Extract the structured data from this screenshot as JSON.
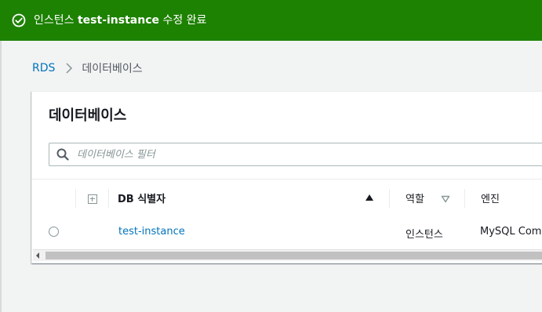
{
  "flash": {
    "icon": "check-circle-icon",
    "prefix": "인스턴스 ",
    "instance_name": "test-instance",
    "suffix": " 수정 완료",
    "color": "#1d8102"
  },
  "breadcrumb": {
    "root": "RDS",
    "separator_icon": "chevron-right-icon",
    "current": "데이터베이스"
  },
  "panel": {
    "title": "데이터베이스",
    "filter": {
      "icon": "search-icon",
      "placeholder": "데이터베이스 필터",
      "value": ""
    },
    "table": {
      "headers": {
        "expand_icon": "expand-all-icon",
        "db_identifier": "DB 식별자",
        "role": "역할",
        "engine": "엔진"
      },
      "rows": [
        {
          "db_identifier": "test-instance",
          "role": "인스턴스",
          "engine": "MySQL Comm"
        }
      ]
    }
  },
  "colors": {
    "link": "#0073bb",
    "success": "#1d8102"
  }
}
